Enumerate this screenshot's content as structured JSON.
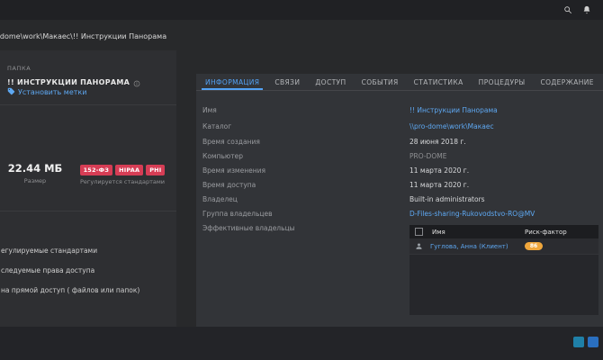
{
  "breadcrumb": {
    "path": "-dome\\work\\Макаес\\!! Инструкции Панорама"
  },
  "sidebar": {
    "section_label": "ПАПКА",
    "folder_title": "!! ИНСТРУКЦИИ ПАНОРАМА",
    "set_labels_link": "Установить метки",
    "size_value": "22.44 МБ",
    "size_caption": "Размер",
    "badges": [
      "152-ФЗ",
      "HIPAA",
      "PHI"
    ],
    "badges_caption": "Регулируется стандартами",
    "list_items": [
      "егулируемые стандартами",
      "следуемые права доступа",
      "на прямой доступ ( файлов или папок)"
    ]
  },
  "tabs": [
    {
      "label": "ИНФОРМАЦИЯ"
    },
    {
      "label": "СВЯЗИ"
    },
    {
      "label": "ДОСТУП"
    },
    {
      "label": "СОБЫТИЯ"
    },
    {
      "label": "СТАТИСТИКА"
    },
    {
      "label": "ПРОЦЕДУРЫ"
    },
    {
      "label": "СОДЕРЖАНИЕ"
    }
  ],
  "info": {
    "rows": [
      {
        "label": "Имя",
        "value": "!! Инструкции Панорама"
      },
      {
        "label": "Каталог",
        "value": "\\\\pro-dome\\work\\Макаес"
      },
      {
        "label": "Время создания",
        "value": "28 июня 2018 г."
      },
      {
        "label": "Компьютер",
        "value": "PRO-DOME"
      },
      {
        "label": "Время изменения",
        "value": "11 марта 2020 г."
      },
      {
        "label": "Время доступа",
        "value": "11 марта 2020 г."
      },
      {
        "label": "Владелец",
        "value": "Built-in administrators"
      },
      {
        "label": "Группа владельцев",
        "value": "D-Files-sharing-Rukovodstvo-RO@MV"
      },
      {
        "label": "Эффективные владельцы",
        "value": ""
      }
    ]
  },
  "owners_table": {
    "name_header": "Имя",
    "risk_header": "Риск-фактор",
    "rows": [
      {
        "name": "Гуглова, Анна (Клиент)",
        "risk": "86"
      }
    ]
  },
  "colors": {
    "accent_blue": "#53a2f5",
    "link_blue": "#5ea8f2",
    "badge_red": "#d63d55",
    "risk_orange": "#f0a73c"
  }
}
